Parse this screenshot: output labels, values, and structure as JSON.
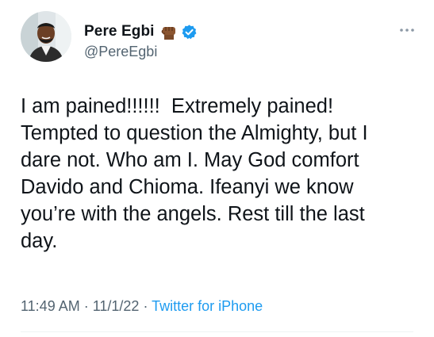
{
  "author": {
    "display_name": "Pere Egbi",
    "handle": "@PereEgbi",
    "emoji_icon": "raised-fist-icon",
    "verified_icon": "verified-badge-icon"
  },
  "tweet": {
    "text": "I am pained!!!!!!  Extremely pained!\nTempted to question the Almighty, but I\ndare not. Who am I. May God comfort\nDavido and Chioma. Ifeanyi we know\nyou’re with the angels. Rest till the last\nday."
  },
  "meta": {
    "time": "11:49 AM",
    "separator": " · ",
    "date": "11/1/22",
    "source": "Twitter for iPhone"
  },
  "colors": {
    "text": "#0f1419",
    "secondary": "#536471",
    "accent": "#1d9bf0"
  }
}
